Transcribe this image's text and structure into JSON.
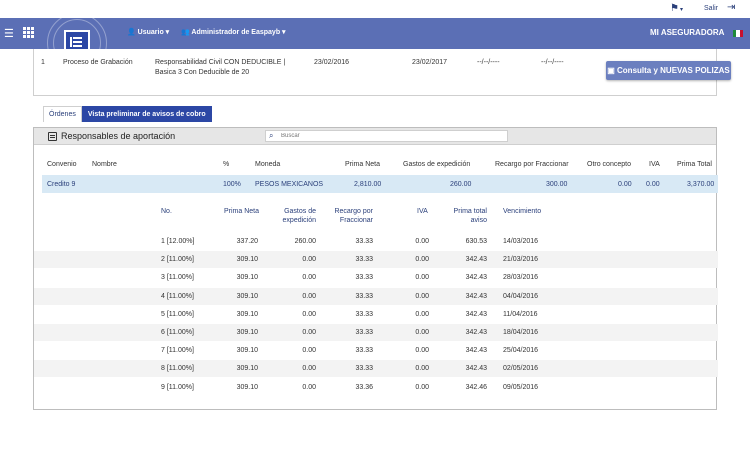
{
  "topbar": {
    "notifications_icon": "flag-icon",
    "logout_label": "Salir",
    "logout_icon": "exit-icon"
  },
  "header": {
    "user_menu": "Usuario",
    "admin_menu": "Administrador de Easpayb",
    "brand": "MI ASEGURADORA",
    "accent": "#5b6fb5"
  },
  "order": {
    "index": "1",
    "process": "Proceso de Grabación",
    "description_line1": "Responsabilidad  Civil  CON  DEDUCIBLE  |",
    "description_line2": "Basica 3 Con Deducible de 20",
    "start_date": "23/02/2016",
    "end_date": "23/02/2017",
    "blank1": "--/--/----",
    "blank2": "--/--/----",
    "consulta_button": "Consulta y NUEVAS POLIZAS"
  },
  "tabs": [
    {
      "label": "Órdenes"
    },
    {
      "label": "Vista preliminar de avisos de cobro"
    }
  ],
  "panel": {
    "title": "Responsables de aportación",
    "search_placeholder": "Buscar"
  },
  "summary_table": {
    "headers": [
      "Convenio",
      "Nombre",
      "%",
      "Moneda",
      "Prima Neta",
      "Gastos de expedición",
      "Recargo por Fraccionar",
      "Otro concepto",
      "IVA",
      "Prima Total"
    ],
    "row": [
      "Credito 9",
      "",
      "100%",
      "PESOS MEXICANOS",
      "2,810.00",
      "260.00",
      "300.00",
      "0.00",
      "0.00",
      "3,370.00"
    ]
  },
  "detail_table": {
    "headers": {
      "no": "No.",
      "prima_neta": "Prima Neta",
      "gastos_1": "Gastos de",
      "gastos_2": "expedición",
      "recargo_1": "Recargo por",
      "recargo_2": "Fraccionar",
      "iva": "IVA",
      "total_1": "Prima total",
      "total_2": "aviso",
      "vencimiento": "Vencimiento"
    },
    "rows": [
      [
        "1 [12.00%]",
        "337.20",
        "260.00",
        "33.33",
        "0.00",
        "630.53",
        "14/03/2016"
      ],
      [
        "2 [11.00%]",
        "309.10",
        "0.00",
        "33.33",
        "0.00",
        "342.43",
        "21/03/2016"
      ],
      [
        "3 [11.00%]",
        "309.10",
        "0.00",
        "33.33",
        "0.00",
        "342.43",
        "28/03/2016"
      ],
      [
        "4 [11.00%]",
        "309.10",
        "0.00",
        "33.33",
        "0.00",
        "342.43",
        "04/04/2016"
      ],
      [
        "5 [11.00%]",
        "309.10",
        "0.00",
        "33.33",
        "0.00",
        "342.43",
        "11/04/2016"
      ],
      [
        "6 [11.00%]",
        "309.10",
        "0.00",
        "33.33",
        "0.00",
        "342.43",
        "18/04/2016"
      ],
      [
        "7 [11.00%]",
        "309.10",
        "0.00",
        "33.33",
        "0.00",
        "342.43",
        "25/04/2016"
      ],
      [
        "8 [11.00%]",
        "309.10",
        "0.00",
        "33.33",
        "0.00",
        "342.43",
        "02/05/2016"
      ],
      [
        "9 [11.00%]",
        "309.10",
        "0.00",
        "33.36",
        "0.00",
        "342.46",
        "09/05/2016"
      ]
    ]
  }
}
